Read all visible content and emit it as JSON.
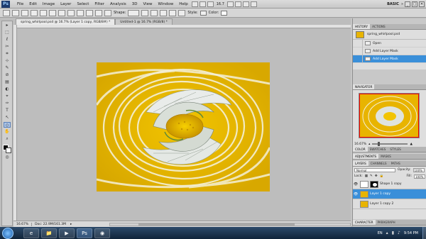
{
  "app": {
    "logo": "Ps"
  },
  "menu": {
    "items": [
      "File",
      "Edit",
      "Image",
      "Layer",
      "Select",
      "Filter",
      "Analysis",
      "3D",
      "View",
      "Window",
      "Help"
    ],
    "zoom": "16.7",
    "workspace": "BASIC",
    "win_buttons": [
      "_",
      "□",
      "✕"
    ]
  },
  "options": {
    "shape_label": "Shape:",
    "style_label": "Style:",
    "color_label": "Color:"
  },
  "tabs": [
    {
      "label": "spring_whirlpool.psd @ 16.7% (Layer 1 copy, RGB/8#) *",
      "active": true
    },
    {
      "label": "Untitled-1 @ 16.7% (RGB/8) *",
      "active": false
    }
  ],
  "toolbox": {
    "tools": [
      "▸",
      "⬚",
      "ℓ",
      "✂",
      "⌗",
      "⊹",
      "✎",
      "⊘",
      "▤",
      "◐",
      "⌖",
      "✑",
      "T",
      "↖",
      "◇",
      "✋",
      "⌕"
    ]
  },
  "status": {
    "zoom": "16.67%",
    "doc": "Doc: 22.9M/161.3M"
  },
  "history": {
    "tabs": [
      "HISTORY",
      "ACTIONS"
    ],
    "snapshot": "spring_whirlpool.psd",
    "rows": [
      {
        "label": "Open",
        "selected": false
      },
      {
        "label": "Add Layer Mask",
        "selected": false
      },
      {
        "label": "Add Layer Mask",
        "selected": true
      }
    ]
  },
  "navigator": {
    "tabs": [
      "NAVIGATOR"
    ],
    "zoom": "16.67%"
  },
  "color_panel": {
    "tabs": [
      "COLOR",
      "SWATCHES",
      "STYLES"
    ]
  },
  "adjustments": {
    "tabs": [
      "ADJUSTMENTS",
      "MASKS"
    ]
  },
  "layers": {
    "tabs": [
      "LAYERS",
      "CHANNELS",
      "PATHS"
    ],
    "blend": "Normal",
    "opacity_label": "Opacity:",
    "opacity": "100%",
    "lock_label": "Lock:",
    "fill_label": "Fill:",
    "fill": "100%",
    "rows": [
      {
        "label": "Shape 1 copy",
        "selected": false,
        "visible": true,
        "has_mask": true
      },
      {
        "label": "Layer 1 copy",
        "selected": true,
        "visible": true,
        "has_mask": false
      },
      {
        "label": "Layer 1 copy 2",
        "selected": false,
        "visible": false,
        "has_mask": false
      }
    ]
  },
  "bottom_panel": {
    "tabs": [
      "CHARACTER",
      "PARAGRAPH"
    ]
  },
  "taskbar": {
    "apps": [
      "e",
      "📁",
      "▶",
      "Ps",
      "◉"
    ],
    "lang": "EN",
    "time": "9:54 PM"
  },
  "colors": {
    "accent": "#3a8fd9",
    "image_yellow": "#e8b400"
  }
}
